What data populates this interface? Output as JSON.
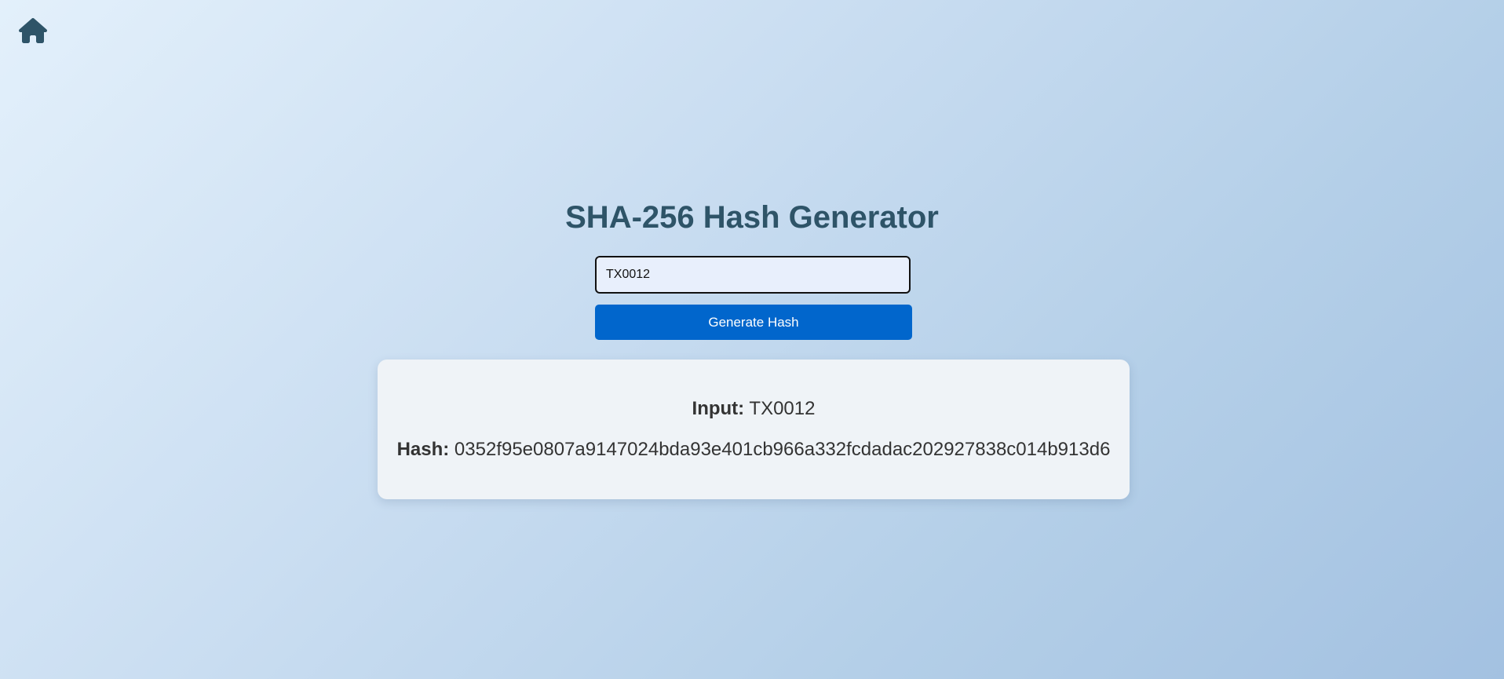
{
  "nav": {
    "home_icon": "home-icon",
    "icon_color": "#2e5468"
  },
  "header": {
    "title": "SHA-256 Hash Generator"
  },
  "form": {
    "input_value": "TX0012",
    "button_label": "Generate Hash"
  },
  "result": {
    "input_label": "Input:",
    "input_value": "TX0012",
    "hash_label": "Hash:",
    "hash_value": "0352f95e0807a9147024bda93e401cb966a332fcdadac202927838c014b913d6"
  },
  "colors": {
    "title": "#2e5468",
    "button": "#0166cc",
    "card": "#eff3f7"
  }
}
